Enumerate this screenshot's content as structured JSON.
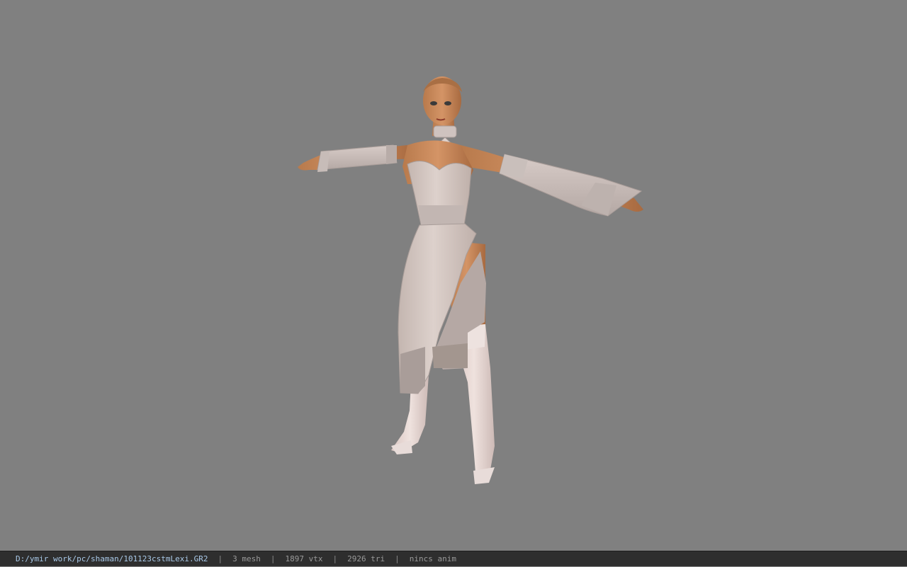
{
  "viewport": {
    "background_color": "#808080",
    "model_description_icon": "character-model"
  },
  "status": {
    "file_path": "D:/ymir work/pc/shaman/101123cstmLexi.GR2",
    "separator": "|",
    "mesh": "3 mesh",
    "vertices": "1897 vtx",
    "triangles": "2926 tri",
    "animation": "nincs anim"
  },
  "colors": {
    "status_bg": "#2e2e2e",
    "path_text": "#a9c9e8",
    "status_text": "#9a9a9a",
    "skin": "#c98a5a",
    "dress": "#d7cbc6",
    "lace": "#b9aeaa"
  }
}
